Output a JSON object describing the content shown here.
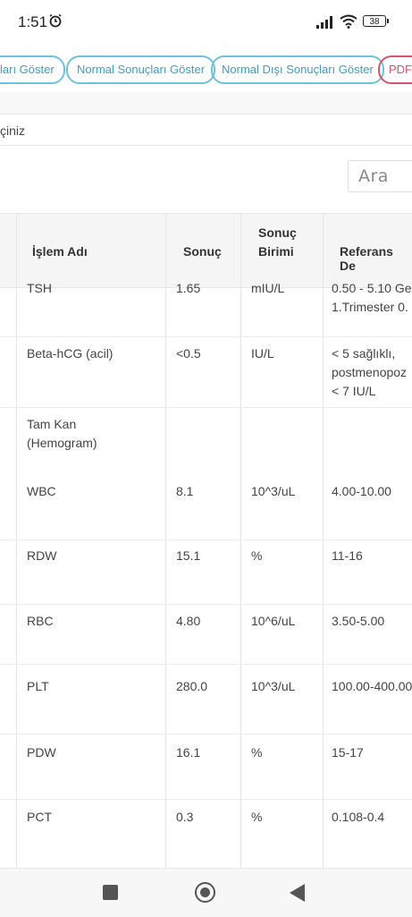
{
  "status_bar": {
    "time": "1:51",
    "battery": "38"
  },
  "filters": [
    {
      "label": "ları Göster"
    },
    {
      "label": "Normal Sonuçları Göster"
    },
    {
      "label": "Normal Dışı Sonuçları Göster"
    },
    {
      "label": "PDF("
    }
  ],
  "select_text": "çiniz",
  "search": {
    "placeholder": "Ara"
  },
  "table": {
    "headers": {
      "name": "İşlem Adı",
      "result": "Sonuç",
      "unit_line1": "Sonuç",
      "unit_line2": "Birimi",
      "reference": "Referans De"
    },
    "rows": [
      {
        "name": "TSH",
        "result": "1.65",
        "unit": "mIU/L",
        "ref1": "0.50 - 5.10 Ge",
        "ref2": "1.Trimester 0.",
        "ref3": ""
      },
      {
        "name": "Beta-hCG (acil)",
        "result": "<0.5",
        "unit": "IU/L",
        "ref1": "< 5 sağlıklı,",
        "ref2": "postmenopoz",
        "ref3": "< 7 IU/L"
      },
      {
        "name": "Tam Kan",
        "name2": "(Hemogram)",
        "result": "",
        "unit": "",
        "ref1": ""
      },
      {
        "name": "WBC",
        "result": "8.1",
        "unit": "10^3/uL",
        "ref1": "4.00-10.00"
      },
      {
        "name": "RDW",
        "result": "15.1",
        "unit": "%",
        "ref1": "11-16"
      },
      {
        "name": "RBC",
        "result": "4.80",
        "unit": "10^6/uL",
        "ref1": "3.50-5.00"
      },
      {
        "name": "PLT",
        "result": "280.0",
        "unit": "10^3/uL",
        "ref1": "100.00-400.00"
      },
      {
        "name": "PDW",
        "result": "16.1",
        "unit": "%",
        "ref1": "15-17"
      },
      {
        "name": "PCT",
        "result": "0.3",
        "unit": "%",
        "ref1": "0.108-0.4"
      }
    ]
  }
}
